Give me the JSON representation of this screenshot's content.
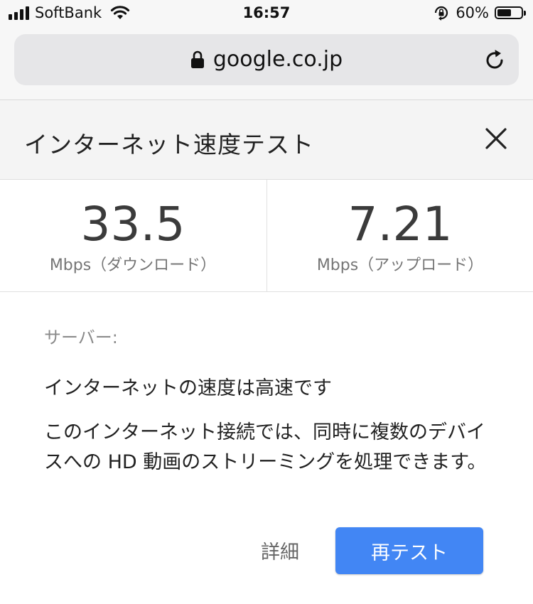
{
  "status_bar": {
    "carrier": "SoftBank",
    "time": "16:57",
    "battery_percent_text": "60%",
    "battery_level": 0.6,
    "signal_icon": "signal-bars-icon",
    "wifi_icon": "wifi-icon",
    "orientation_lock_icon": "orientation-lock-icon"
  },
  "browser": {
    "url": "google.co.jp",
    "lock_icon": "lock-icon",
    "reload_icon": "reload-icon"
  },
  "speed_test": {
    "title": "インターネット速度テスト",
    "close_icon": "close-icon",
    "download": {
      "value": "33.5",
      "unit": "Mbps（ダウンロード）"
    },
    "upload": {
      "value": "7.21",
      "unit": "Mbps（アップロード）"
    },
    "server_label": "サーバー:",
    "headline": "インターネットの速度は高速です",
    "description": "このインターネット接続では、同時に複数のデバイスへの HD 動画のストリーミングを処理できます。",
    "details_label": "詳細",
    "retest_label": "再テスト"
  },
  "colors": {
    "accent": "#4286f4",
    "header_bg": "#f4f4f4",
    "url_bar_bg": "#e6e6e8"
  }
}
